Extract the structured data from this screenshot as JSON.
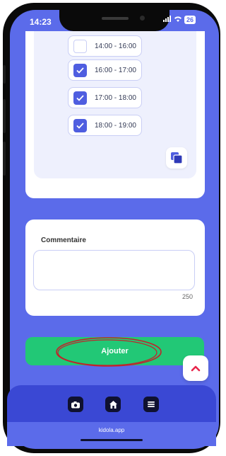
{
  "status_bar": {
    "time": "14:23",
    "signal": "..il",
    "battery": "26"
  },
  "time_slots": [
    {
      "label": "14:00 - 16:00",
      "checked": false
    },
    {
      "label": "16:00 - 17:00",
      "checked": true
    },
    {
      "label": "17:00 - 18:00",
      "checked": true
    },
    {
      "label": "18:00 - 19:00",
      "checked": true
    }
  ],
  "comment": {
    "label": "Commentaire",
    "value": "",
    "placeholder": "",
    "char_count": "250"
  },
  "add_button": {
    "label": "Ajouter"
  },
  "nav": {
    "items": [
      "camera-icon",
      "home-icon",
      "menu-icon"
    ]
  },
  "footer": {
    "url": "kidola.app"
  },
  "colors": {
    "background": "#5b6bea",
    "accent": "#4f5ee0",
    "primary_button": "#22c876",
    "nav": "#3a48d4"
  }
}
